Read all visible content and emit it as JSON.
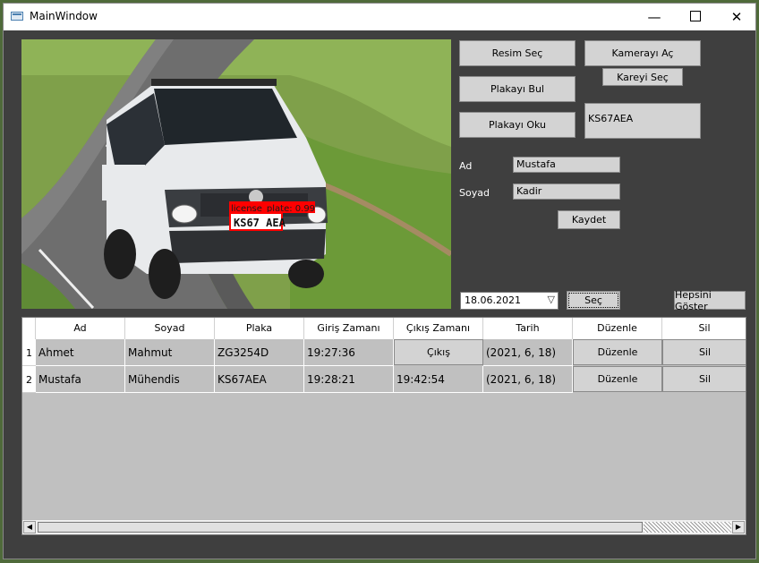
{
  "window": {
    "title": "MainWindow",
    "minimize": "—",
    "close": "✕"
  },
  "photo": {
    "detection_label": "license_plate: 0.99",
    "plate_text": "KS67 AEA"
  },
  "buttons": {
    "resim_sec": "Resim Seç",
    "kamerayi_ac": "Kamerayı Aç",
    "kareyi_sec": "Kareyi Seç",
    "plakayi_bul": "Plakayı Bul",
    "plakayi_oku": "Plakayı Oku",
    "kaydet": "Kaydet",
    "sec": "Seç",
    "hepsini_goster": "Hepsini Göster"
  },
  "plate_result": "KS67AEA",
  "form": {
    "ad_label": "Ad",
    "ad_value": "Mustafa",
    "soyad_label": "Soyad",
    "soyad_value": "Kadir"
  },
  "date_combo": {
    "value": "18.06.2021"
  },
  "table": {
    "headers": [
      "Ad",
      "Soyad",
      "Plaka",
      "Giriş Zamanı",
      "Çıkış Zamanı",
      "Tarih",
      "Düzenle",
      "Sil"
    ],
    "rows": [
      {
        "index": "1",
        "ad": "Ahmet",
        "soyad": "Mahmut",
        "plaka": "ZG3254D",
        "giris": "19:27:36",
        "cikis_button": "Çıkış",
        "tarih": "(2021, 6, 18)",
        "duzenle": "Düzenle",
        "sil": "Sil"
      },
      {
        "index": "2",
        "ad": "Mustafa",
        "soyad": "Mühendis",
        "plaka": "KS67AEA",
        "giris": "19:28:21",
        "cikis": "19:42:54",
        "tarih": "(2021, 6, 18)",
        "duzenle": "Düzenle",
        "sil": "Sil"
      }
    ]
  },
  "colors": {
    "panel": "#3f3f3f",
    "button": "#d3d3d3",
    "table_bg": "#c0c0c0",
    "detection": "#ff0000"
  }
}
